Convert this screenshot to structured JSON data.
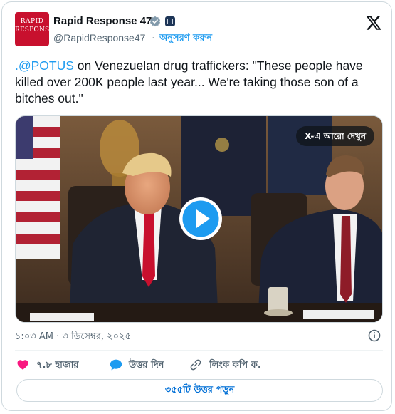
{
  "account": {
    "name": "Rapid Response 47",
    "handle": "@RapidResponse47",
    "separator": "·",
    "follow_label": "অনুসরণ করুন",
    "avatar_text_line1": "RAPID",
    "avatar_text_line2": "RESPONSE"
  },
  "post": {
    "mention": ".@POTUS",
    "text": " on Venezuelan drug traffickers: \"These people have killed over 200K people last year... We're taking those son of a bitches out.\""
  },
  "media": {
    "see_more_label": "X-এ আরো দেখুন"
  },
  "meta": {
    "timestamp": "১:০৩ AM · ৩ ডিসেম্বর, ২০২৫"
  },
  "actions": {
    "likes": "৭.৮ হাজার",
    "reply_label": "উত্তর দিন",
    "copy_link_label": "লিংক কপি ক."
  },
  "read_replies_label": "৩৫৫টি উত্তর পড়ুন",
  "colors": {
    "accent": "#1d9bf0",
    "heart": "#f91880",
    "avatar_bg": "#c8102e"
  }
}
